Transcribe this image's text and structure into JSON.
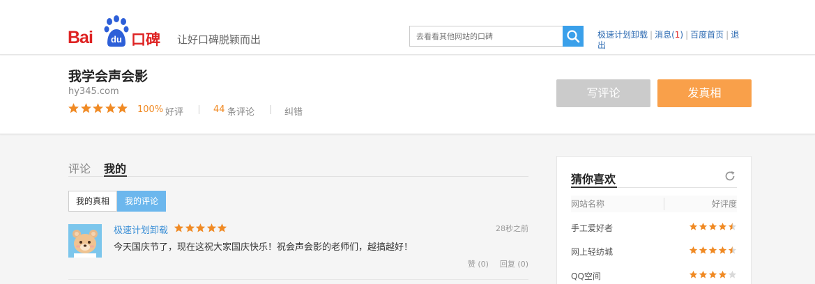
{
  "header": {
    "logo_text": "Bai du 口碑",
    "slogan": "让好口碑脱颖而出",
    "search_placeholder": "去看看其他网站的口碑",
    "links": {
      "plan_uninstall": "极速计划卸载",
      "messages": "消息",
      "messages_count": "1",
      "baidu_home": "百度首页",
      "logout": "退出"
    }
  },
  "site": {
    "title": "我学会声会影",
    "url": "hy345.com",
    "star_rating": 5,
    "good_pct": "100%",
    "good_label": "好评",
    "review_count": "44",
    "review_label": "条评论",
    "correct_label": "纠错",
    "write_review_btn": "写评论",
    "post_truth_btn": "发真相"
  },
  "main": {
    "tabs": [
      {
        "label": "评论",
        "active": false
      },
      {
        "label": "我的",
        "active": true
      }
    ],
    "subtabs": [
      {
        "label": "我的真相",
        "active": false
      },
      {
        "label": "我的评论",
        "active": true
      }
    ],
    "comments": [
      {
        "user": "极速计划卸载",
        "stars": 5,
        "time": "28秒之前",
        "text": "今天国庆节了，现在这祝大家国庆快乐！祝会声会影的老师们，越搞越好！",
        "like": "赞 (0)",
        "reply": "回复 (0)"
      }
    ]
  },
  "sidebar": {
    "title": "猜你喜欢",
    "col_name": "网站名称",
    "col_rating": "好评度",
    "rows": [
      {
        "name": "手工爱好者",
        "rating": 4.5
      },
      {
        "name": "网上轻纺城",
        "rating": 4.5
      },
      {
        "name": "QQ空间",
        "rating": 4
      }
    ]
  },
  "colors": {
    "brand_red": "#de2323",
    "brand_blue": "#2d5fd8",
    "star_orange": "#f08a24",
    "link_blue": "#2c6ab2",
    "accent_blue": "#3aa0ea",
    "orange_button": "#f9a04a",
    "grey_button": "#cbcbcb"
  }
}
